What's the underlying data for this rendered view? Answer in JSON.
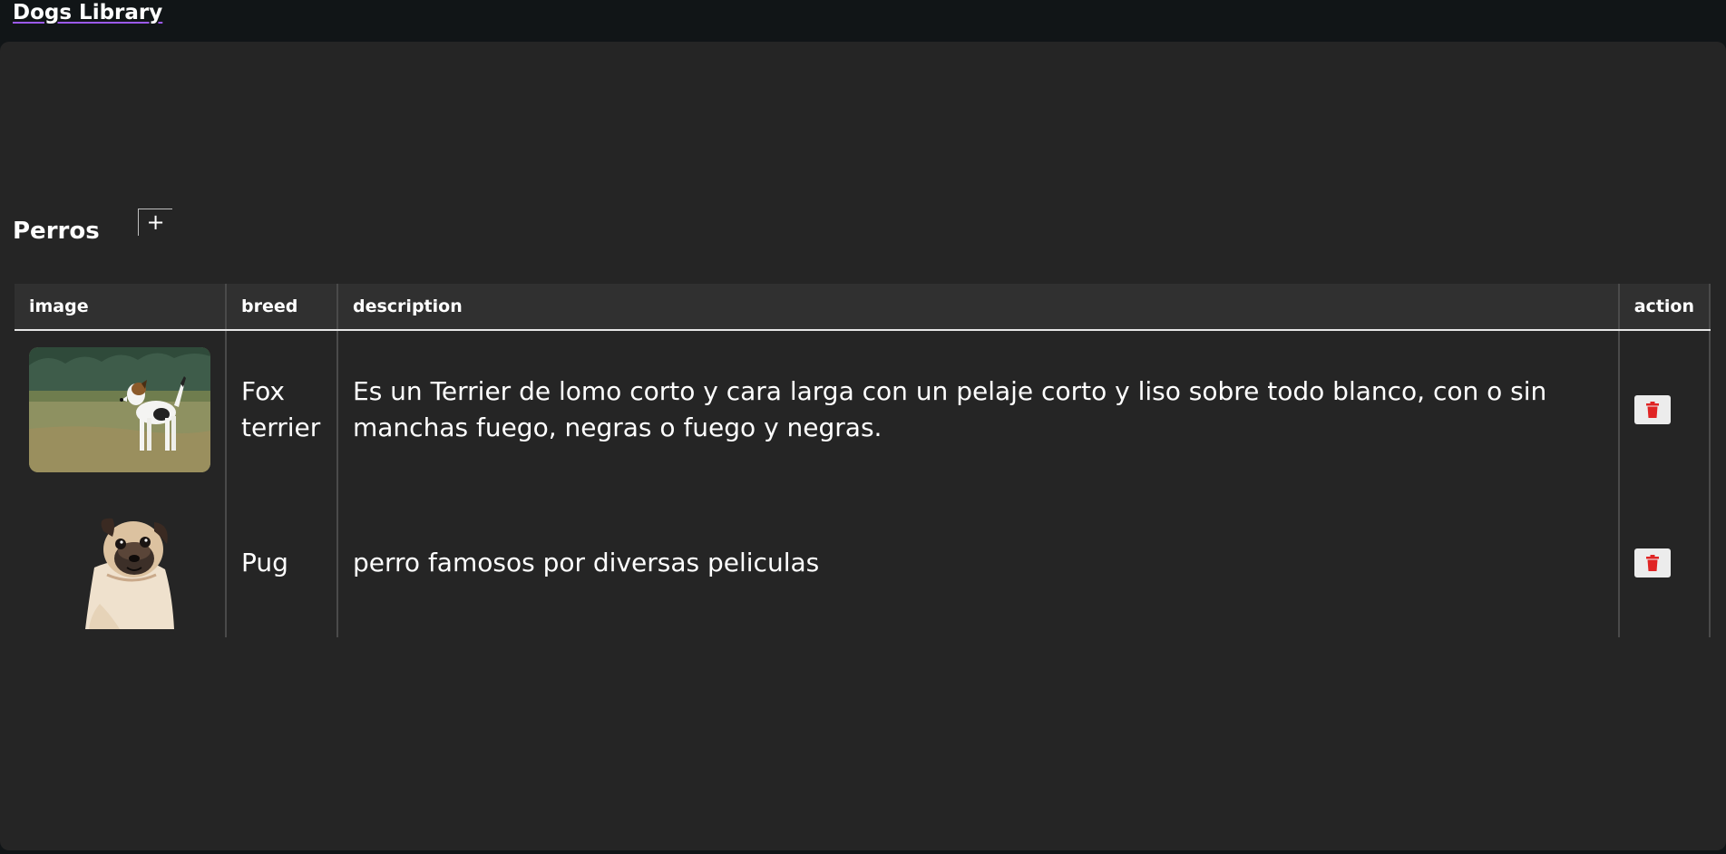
{
  "header": {
    "brand": "Dogs Library"
  },
  "section": {
    "title": "Perros",
    "add_label": "+"
  },
  "table": {
    "columns": [
      "image",
      "breed",
      "description",
      "action"
    ],
    "rows": [
      {
        "breed": "Fox terrier",
        "description": "Es un Terrier de lomo corto y cara larga con un pelaje corto y liso sobre todo blanco, con o sin manchas fuego, negras o fuego y negras.",
        "image_icon": "fox-terrier-photo",
        "action_icon": "trash-icon"
      },
      {
        "breed": "Pug",
        "description": "perro famosos por diversas peliculas",
        "image_icon": "pug-photo",
        "action_icon": "trash-icon"
      }
    ]
  },
  "colors": {
    "page_bg": "#111517",
    "panel_bg": "#252525",
    "header_bg": "#303030",
    "delete_red": "#e02424"
  }
}
